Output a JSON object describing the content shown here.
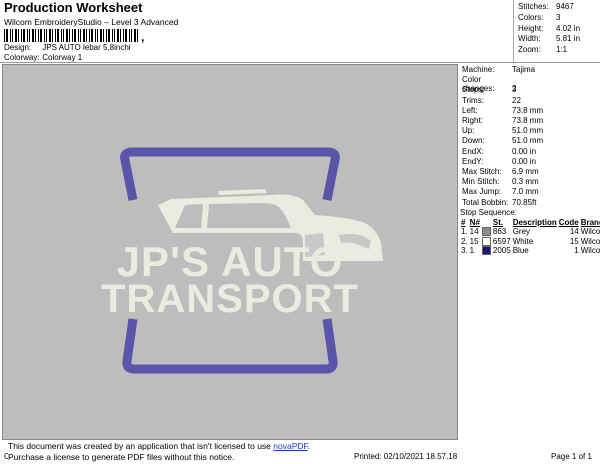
{
  "header": {
    "title": "Production Worksheet",
    "subtitle": "Wilcom EmbroideryStudio – Level 3 Advanced",
    "barcode_suffix": ","
  },
  "meta": [
    {
      "label": "Design:",
      "value": "JPS AUTO lebar  5,8inchi"
    },
    {
      "label": "Colorway:",
      "value": "Colorway 1"
    }
  ],
  "stats": [
    {
      "label": "Stitches:",
      "value": "9467"
    },
    {
      "label": "Colors:",
      "value": "3"
    },
    {
      "label": "Height:",
      "value": "4.02 in"
    },
    {
      "label": "Width:",
      "value": "5.81 in"
    },
    {
      "label": "Zoom:",
      "value": "1:1"
    }
  ],
  "machine": [
    {
      "label": "Machine:",
      "value": "Tajima"
    },
    {
      "label": "Color changes:",
      "value": "2"
    },
    {
      "label": "Stops:",
      "value": "3"
    },
    {
      "label": "Trims:",
      "value": "22"
    },
    {
      "label": "Left:",
      "value": "73.8 mm"
    },
    {
      "label": "Right:",
      "value": "73.8 mm"
    },
    {
      "label": "Up:",
      "value": "51.0 mm"
    },
    {
      "label": "Down:",
      "value": "51.0 mm"
    },
    {
      "label": "EndX:",
      "value": "0.00 in"
    },
    {
      "label": "EndY:",
      "value": "0.00 in"
    },
    {
      "label": "Max Stitch:",
      "value": "6.9 mm"
    },
    {
      "label": "Min Stitch:",
      "value": "0.3 mm"
    },
    {
      "label": "Max Jump:",
      "value": "7.0 mm"
    },
    {
      "label": "Total Bobbin:",
      "value": "70.85ft"
    }
  ],
  "stop_sequence": {
    "title": "Stop Sequence:",
    "columns": [
      "#",
      "N#",
      "St.",
      "Description",
      "Code",
      "Brand"
    ],
    "rows": [
      {
        "num": "1.",
        "n": "14",
        "color": "#8c8c8c",
        "st": "863",
        "desc": "Grey",
        "code": "14",
        "brand": "Wilcom"
      },
      {
        "num": "2.",
        "n": "15",
        "color": "#ffffff",
        "st": "6597",
        "desc": "White",
        "code": "15",
        "brand": "Wilcom"
      },
      {
        "num": "3.",
        "n": "1",
        "color": "#1c1a6e",
        "st": "2005",
        "desc": "Blue",
        "code": "1",
        "brand": "Wilcom"
      }
    ]
  },
  "design": {
    "line1": "JP'S AUTO",
    "line2": "TRANSPORT",
    "frame_color": "#5a55a8",
    "fill_color": "#e9ecdf"
  },
  "footer": {
    "notice_line1_a": "This document was created by an application that isn't licensed to use ",
    "notice_link": "novaPDF",
    "notice_line1_b": ".",
    "notice_line2": "Purchase a license to generate PDF files without this notice.",
    "cr": "Cr",
    "printed": "Printed: 02/10/2021 18.57.18",
    "page": "Page 1 of 1"
  }
}
